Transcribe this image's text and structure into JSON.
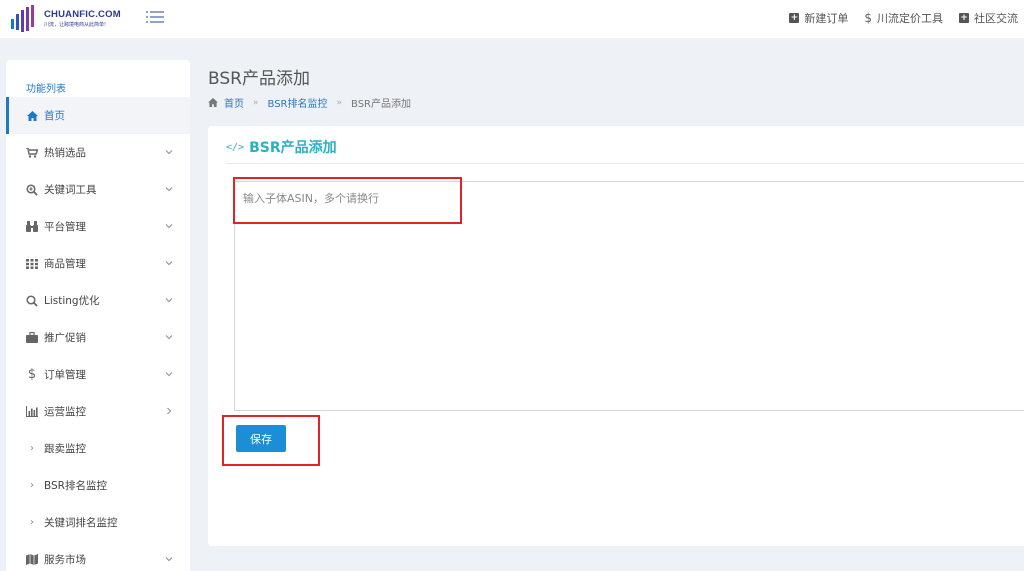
{
  "brand": {
    "name": "CHUANFIC.COM",
    "tagline": "川流，让跨境电商从此简单!"
  },
  "topnav": {
    "new_order": "新建订单",
    "pricing_tool": "川流定价工具",
    "community": "社区交流"
  },
  "sidebar": {
    "title": "功能列表",
    "items": [
      {
        "label": "首页",
        "icon": "home-icon"
      },
      {
        "label": "热销选品",
        "icon": "cart-icon"
      },
      {
        "label": "关键词工具",
        "icon": "search-plus-icon"
      },
      {
        "label": "平台管理",
        "icon": "binoculars-icon"
      },
      {
        "label": "商品管理",
        "icon": "grid-icon"
      },
      {
        "label": "Listing优化",
        "icon": "search-icon"
      },
      {
        "label": "推广促销",
        "icon": "briefcase-icon"
      },
      {
        "label": "订单管理",
        "icon": "dollar-icon"
      },
      {
        "label": "运营监控",
        "icon": "bar-chart-icon"
      }
    ],
    "sub_items": [
      {
        "label": "跟卖监控"
      },
      {
        "label": "BSR排名监控"
      },
      {
        "label": "关键词排名监控"
      }
    ],
    "last_item": {
      "label": "服务市场",
      "icon": "map-icon"
    }
  },
  "page": {
    "title": "BSR产品添加",
    "breadcrumb": {
      "home": "首页",
      "parent": "BSR排名监控",
      "current": "BSR产品添加"
    }
  },
  "panel": {
    "title": "BSR产品添加",
    "textarea_placeholder": "输入子体ASIN，多个请换行",
    "textarea_value": "",
    "save_label": "保存"
  },
  "colors": {
    "accent": "#1e78c8",
    "teal_title": "#2ab0c6",
    "button": "#1b8ed6",
    "highlight": "#e02424",
    "background": "#eef1f5"
  }
}
